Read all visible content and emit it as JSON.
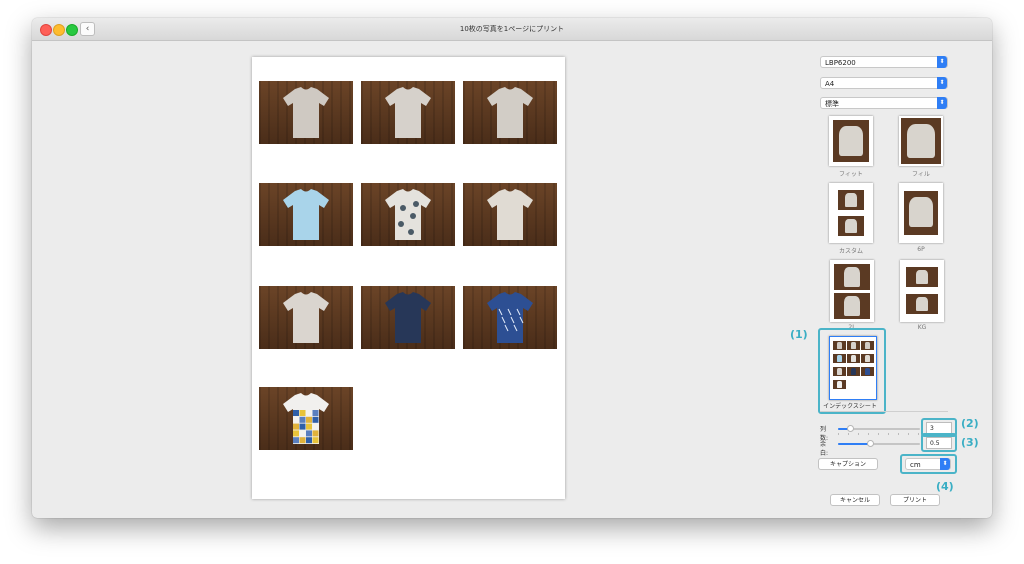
{
  "window": {
    "title": "10枚の写真を1ページにプリント"
  },
  "printer": {
    "selected": "LBP6200"
  },
  "paper": {
    "selected": "A4"
  },
  "quality": {
    "selected": "標準"
  },
  "layouts": [
    {
      "label": "フィット"
    },
    {
      "label": "フィル"
    },
    {
      "label": "カスタム"
    },
    {
      "label": "6P"
    },
    {
      "label": "2L"
    },
    {
      "label": "KG"
    },
    {
      "label": "インデックスシート"
    }
  ],
  "columns": {
    "label": "列数:",
    "value": "3",
    "level": 0.15
  },
  "margin": {
    "label": "余白:",
    "value": "0.5",
    "level": 0.4
  },
  "caption_button": "キャプション",
  "unit": {
    "selected": "cm"
  },
  "cancel_button": "キャンセル",
  "print_button": "プリント",
  "callouts": [
    "(1)",
    "(2)",
    "(3)",
    "(4)"
  ],
  "photos": [
    {
      "shirt": "#cfc9c2",
      "pattern": "none"
    },
    {
      "shirt": "#d6d1cb",
      "pattern": "none"
    },
    {
      "shirt": "#d2cdc6",
      "pattern": "none"
    },
    {
      "shirt": "#a9d4ea",
      "pattern": "none"
    },
    {
      "shirt": "#e4e2dd",
      "pattern": "floral"
    },
    {
      "shirt": "#e0dbd3",
      "pattern": "none"
    },
    {
      "shirt": "#dad5cf",
      "pattern": "none"
    },
    {
      "shirt": "#273758",
      "pattern": "none"
    },
    {
      "shirt": "#2d4f93",
      "pattern": "print"
    },
    {
      "shirt": "#f1f0ee",
      "pattern": "blocks"
    }
  ],
  "colors": {
    "accent": "#2f7ef5",
    "callout": "#4bb4c8",
    "wood": "#5b3a23"
  }
}
